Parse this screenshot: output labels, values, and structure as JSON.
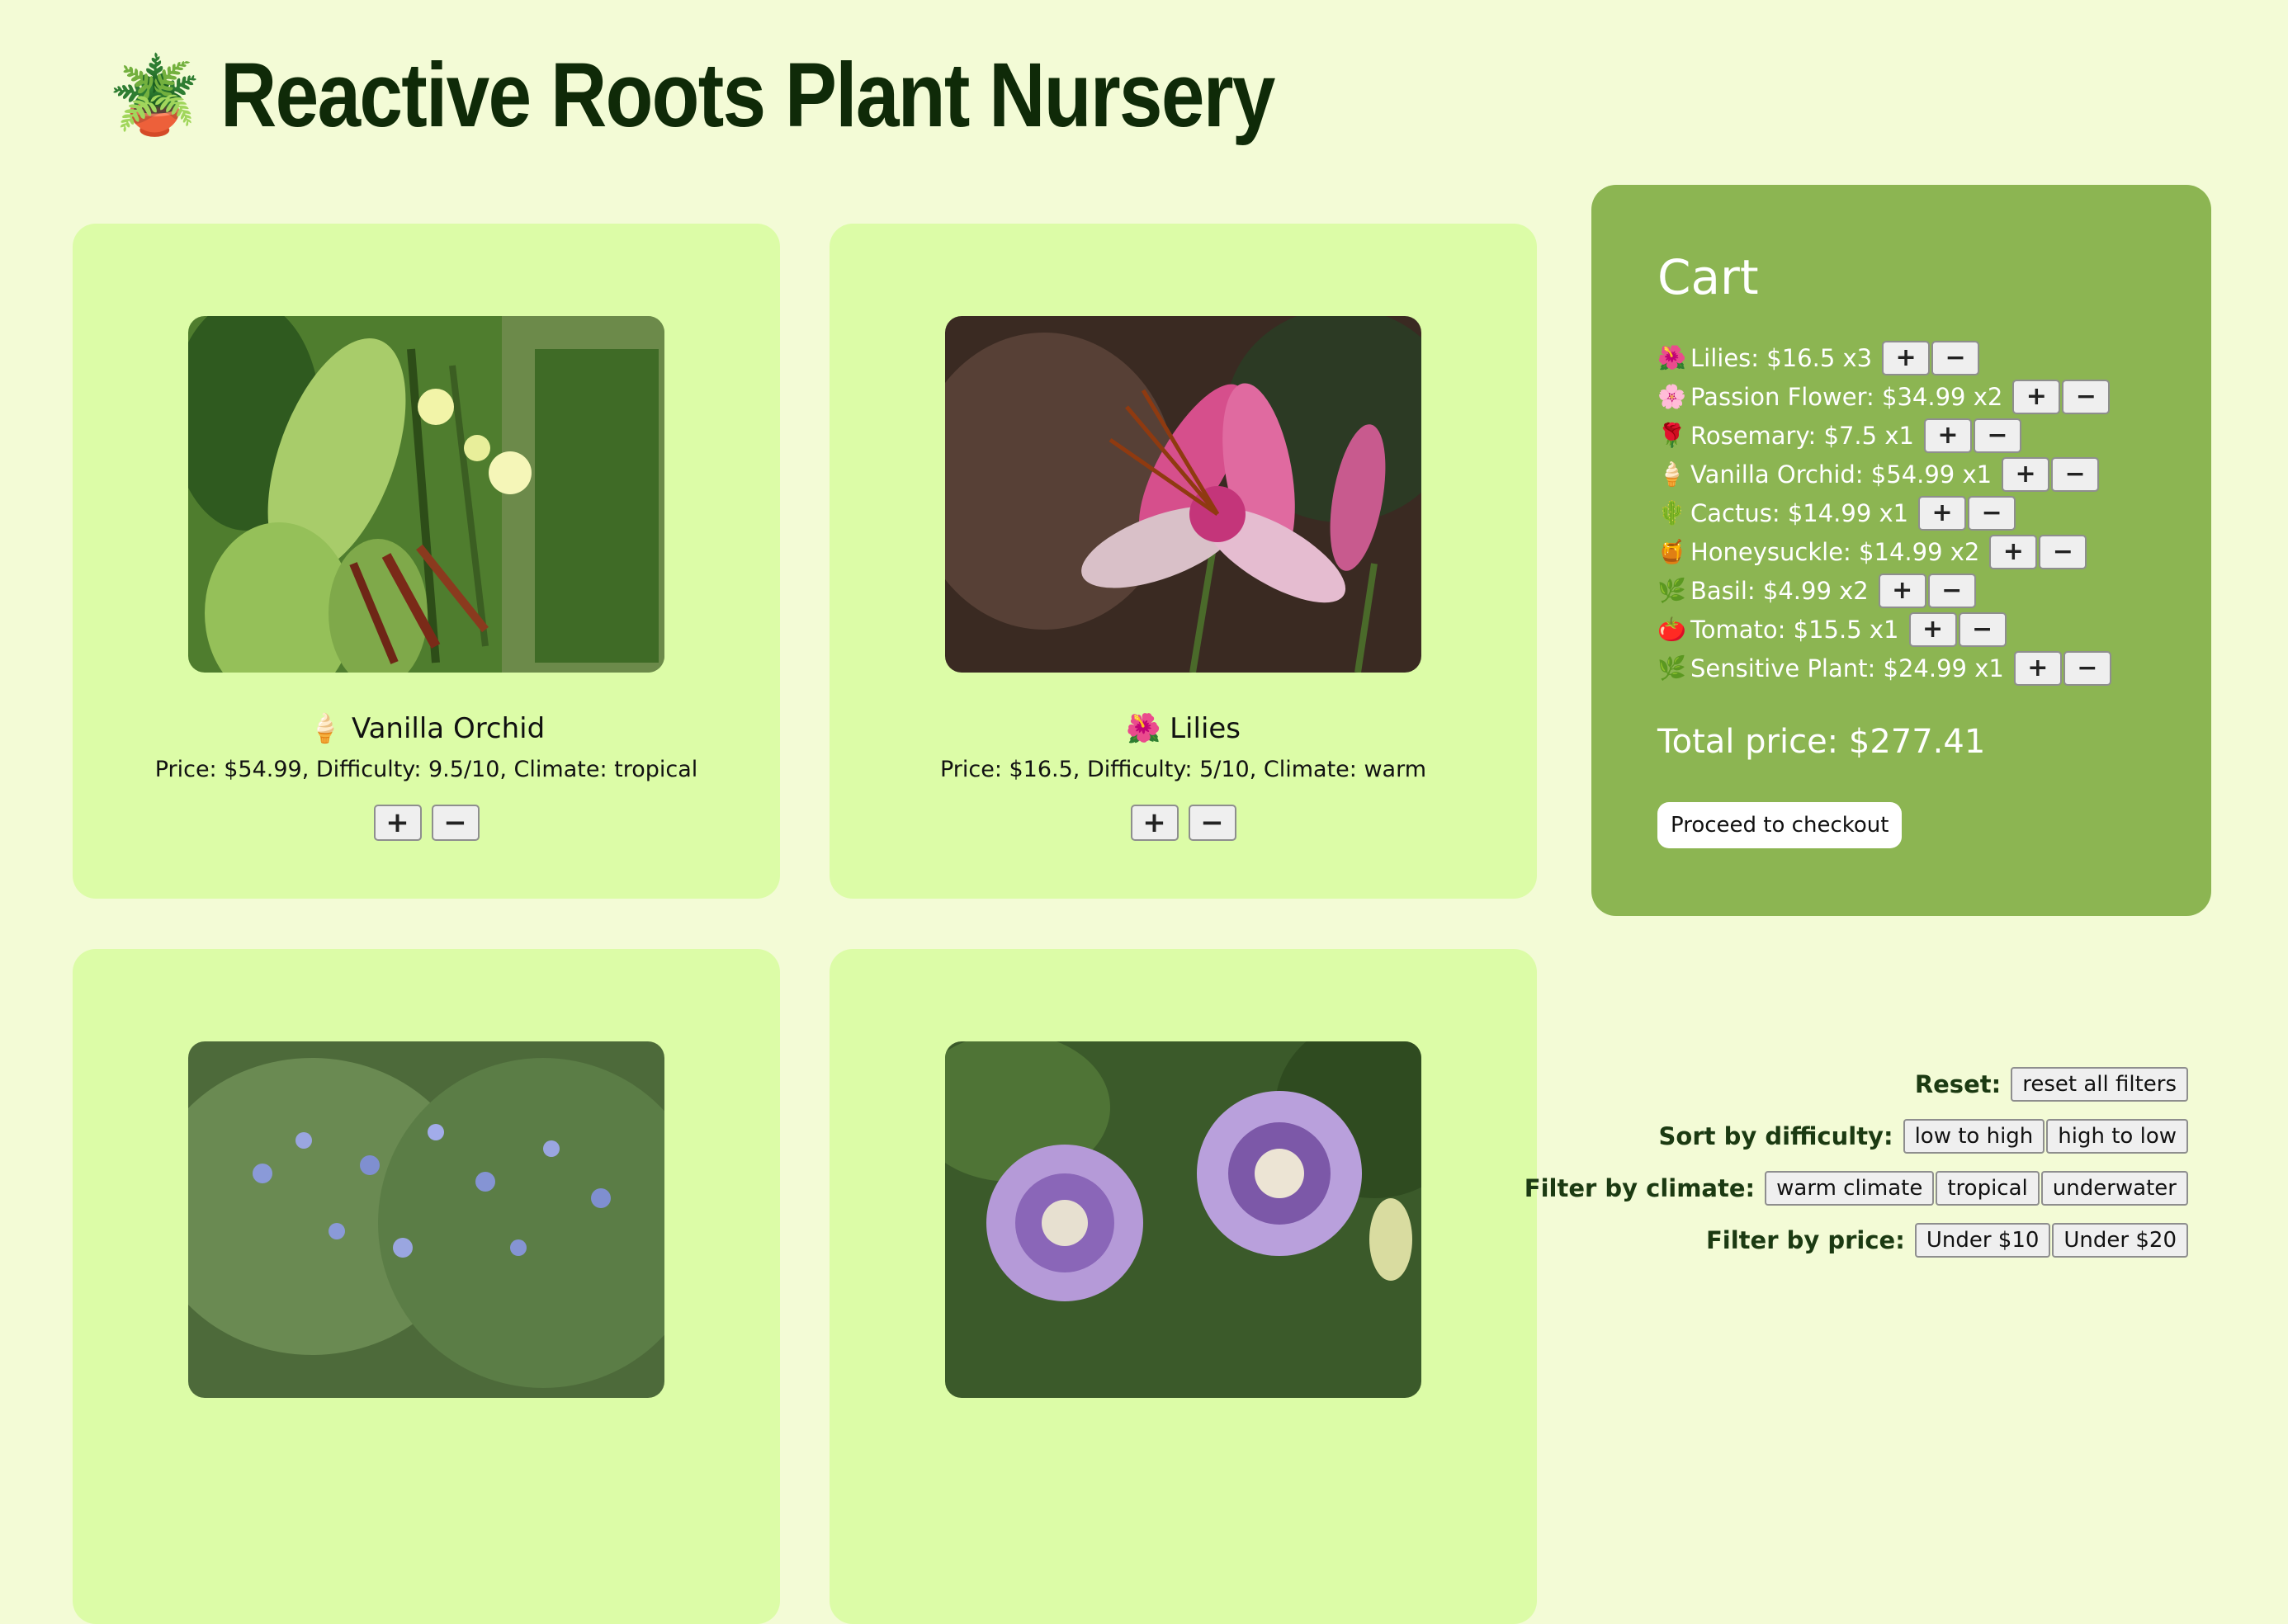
{
  "header": {
    "icon": "potted-plant-icon",
    "pot": "🪴",
    "title": "Reactive Roots Plant Nursery"
  },
  "products": [
    {
      "emoji": "🍦",
      "name": "Vanilla Orchid",
      "info": "Price: $54.99, Difficulty: 9.5/10, Climate: tropical"
    },
    {
      "emoji": "🌺",
      "name": "Lilies",
      "info": "Price: $16.5, Difficulty: 5/10, Climate: warm"
    },
    {
      "emoji": "",
      "name": "",
      "info": ""
    },
    {
      "emoji": "",
      "name": "",
      "info": ""
    }
  ],
  "buttons": {
    "plus": "+",
    "minus": "−"
  },
  "cart": {
    "title": "Cart",
    "items": [
      {
        "emoji": "🌺",
        "text": "Lilies: $16.5 x3"
      },
      {
        "emoji": "🌸",
        "text": "Passion Flower: $34.99 x2"
      },
      {
        "emoji": "🌹",
        "text": "Rosemary: $7.5 x1"
      },
      {
        "emoji": "🍦",
        "text": "Vanilla Orchid: $54.99 x1"
      },
      {
        "emoji": "🌵",
        "text": "Cactus: $14.99 x1"
      },
      {
        "emoji": "🍯",
        "text": "Honeysuckle: $14.99 x2"
      },
      {
        "emoji": "🌿",
        "text": "Basil: $4.99 x2"
      },
      {
        "emoji": "🍅",
        "text": "Tomato: $15.5 x1"
      },
      {
        "emoji": "🌿",
        "text": "Sensitive Plant: $24.99 x1"
      }
    ],
    "total": "Total price: $277.41",
    "checkout": "Proceed to checkout"
  },
  "filters": {
    "reset_label": "Reset:",
    "reset_button": "reset all filters",
    "sort_label": "Sort by difficulty:",
    "sort_low": "low to high",
    "sort_high": "high to low",
    "climate_label": "Filter by climate:",
    "climate_warm": "warm climate",
    "climate_tropical": "tropical",
    "climate_underwater": "underwater",
    "price_label": "Filter by price:",
    "price_10": "Under $10",
    "price_20": "Under $20"
  },
  "colors": {
    "page_bg": "#f3fbd6",
    "card_bg": "#dcfca7",
    "cart_bg": "#8cb552",
    "title": "#0f2a08"
  }
}
